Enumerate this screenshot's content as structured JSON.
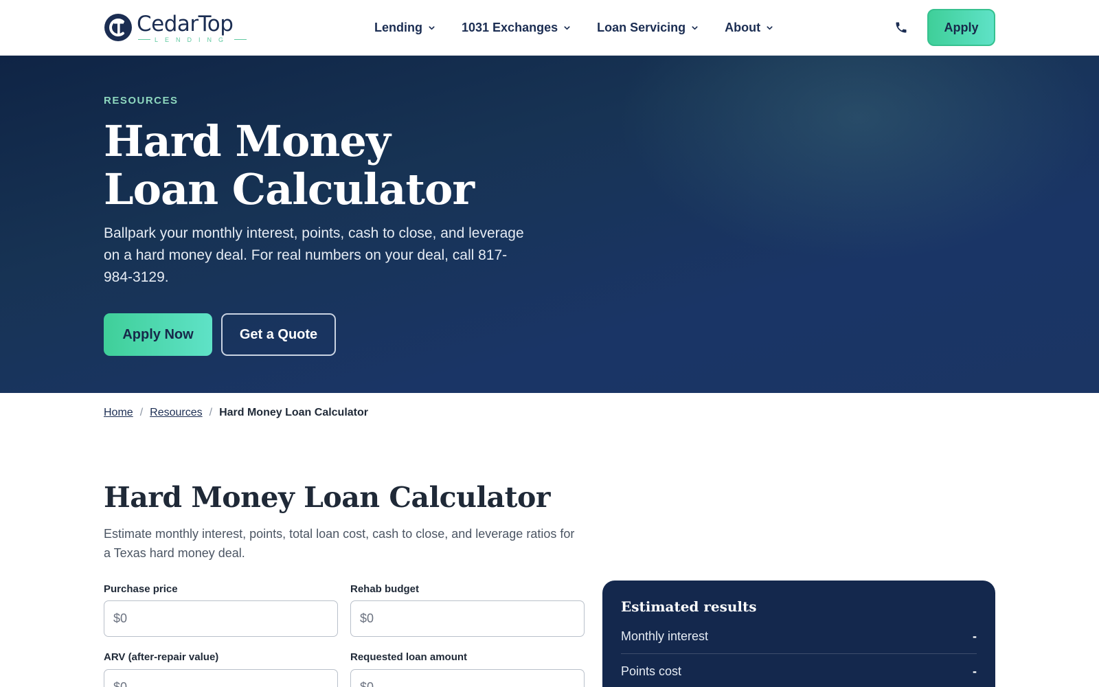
{
  "header": {
    "logo": {
      "name": "CedarTop",
      "sub": "LENDING"
    },
    "nav": [
      {
        "label": "Lending"
      },
      {
        "label": "1031 Exchanges"
      },
      {
        "label": "Loan Servicing"
      },
      {
        "label": "About"
      }
    ],
    "apply_label": "Apply"
  },
  "hero": {
    "eyebrow": "RESOURCES",
    "title_line1": "Hard Money",
    "title_line2": "Loan Calculator",
    "description": "Ballpark your monthly interest, points, cash to close, and leverage on a hard money deal. For real numbers on your deal, call 817-984-3129.",
    "primary_button": "Apply Now",
    "secondary_button": "Get a Quote"
  },
  "breadcrumb": {
    "home": "Home",
    "resources": "Resources",
    "current": "Hard Money Loan Calculator"
  },
  "main": {
    "title": "Hard Money Loan Calculator",
    "description": "Estimate monthly interest, points, total loan cost, cash to close, and leverage ratios for a Texas hard money deal.",
    "fields": {
      "purchase_price": {
        "label": "Purchase price",
        "placeholder": "$0"
      },
      "rehab_budget": {
        "label": "Rehab budget",
        "placeholder": "$0"
      },
      "arv": {
        "label": "ARV (after-repair value)",
        "placeholder": "$0"
      },
      "loan_amount": {
        "label": "Requested loan amount",
        "placeholder": "$0"
      }
    }
  },
  "results": {
    "title": "Estimated results",
    "rows": [
      {
        "label": "Monthly interest",
        "value": "-"
      },
      {
        "label": "Points cost",
        "value": "-"
      }
    ]
  },
  "colors": {
    "brand_navy": "#1b2d52",
    "accent_green": "#3fcf99",
    "hero_bg": "#173354",
    "results_bg": "#14284d"
  }
}
